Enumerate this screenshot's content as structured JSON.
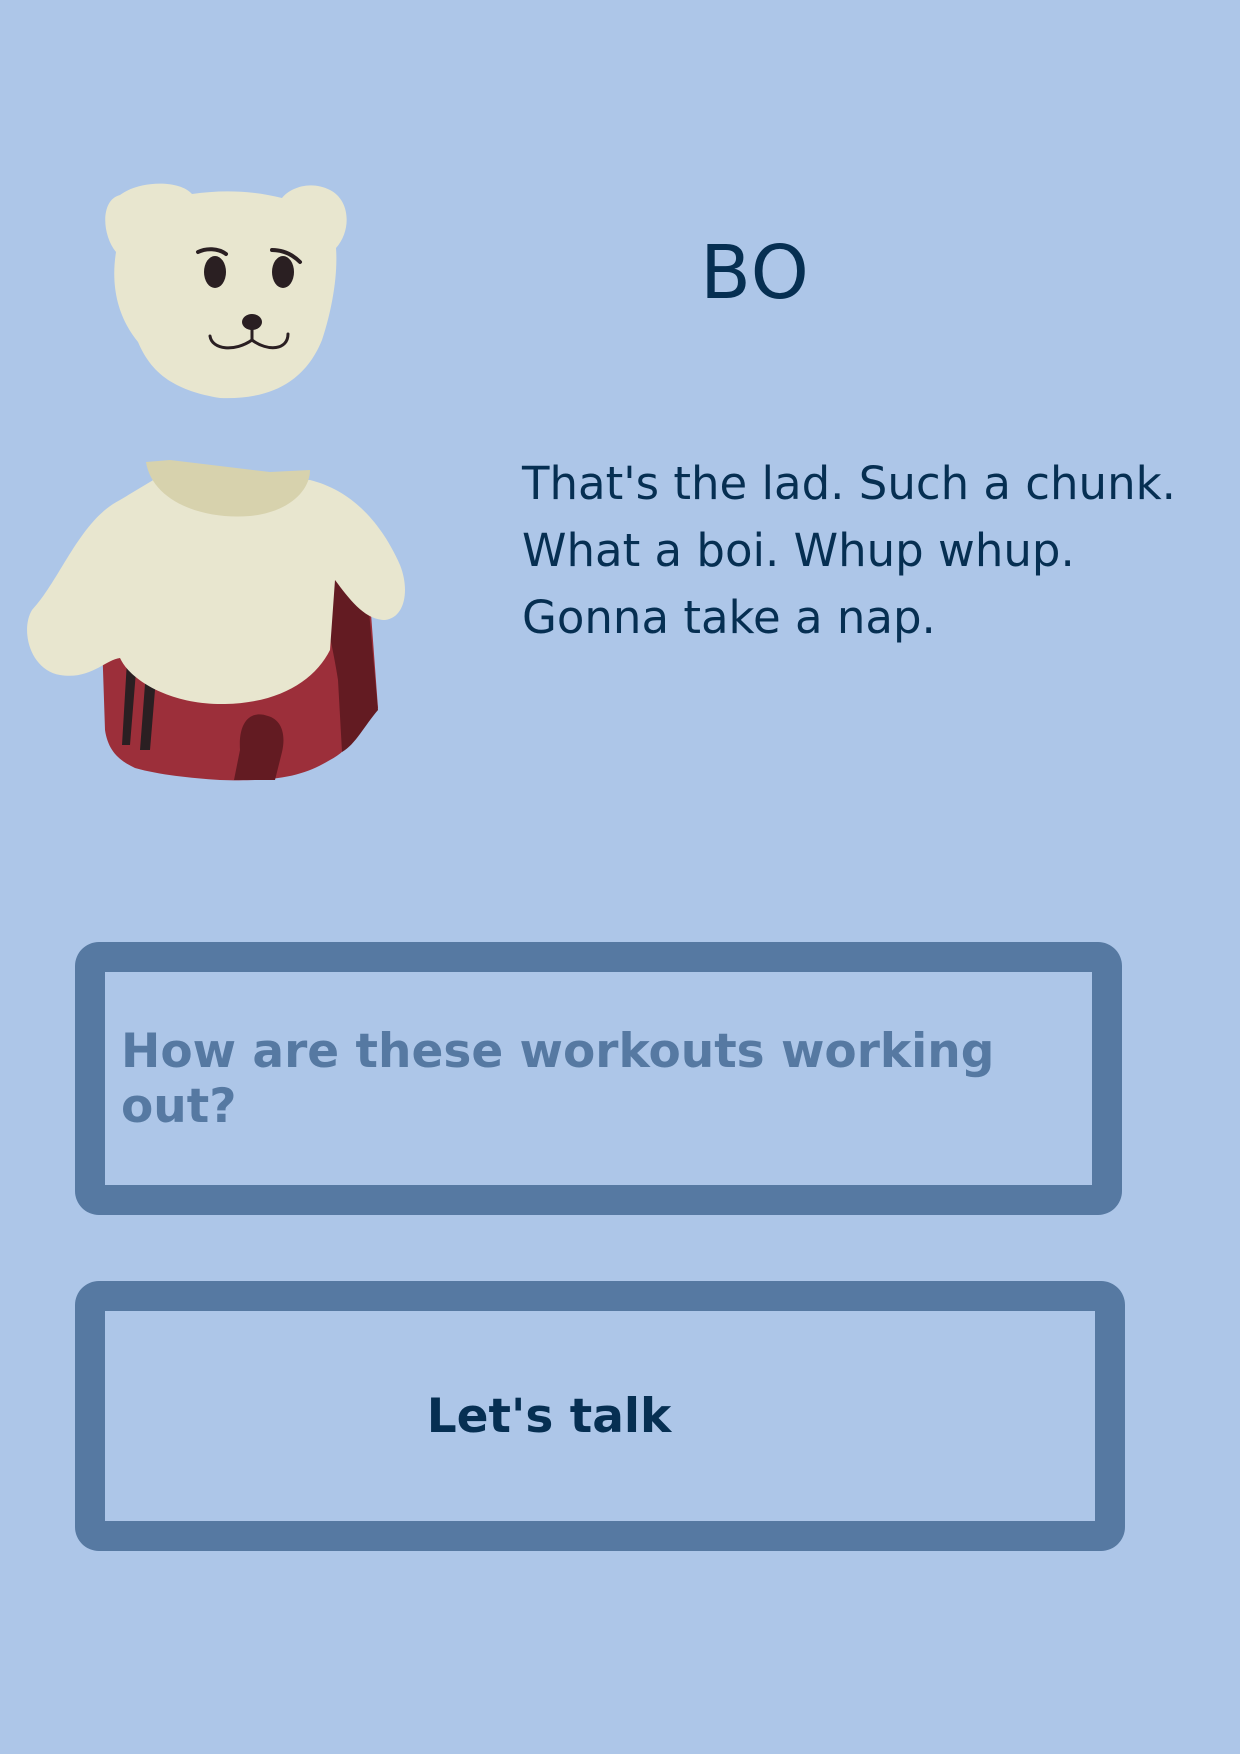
{
  "character": {
    "name": "BO",
    "portrait": "polar-bear-in-red-tracksuit-pants"
  },
  "dialogue": {
    "lines": [
      "That's the lad. Such a chunk.",
      "What a boi. Whup whup.",
      "Gonna take a nap."
    ]
  },
  "choices": [
    {
      "label": "How are these workouts working out?",
      "state": "dimmed"
    },
    {
      "label": "Let's talk",
      "state": "active"
    }
  ],
  "colors": {
    "background": "#adc6e8",
    "text": "#062f52",
    "button_border": "#5679a2",
    "bear_fur": "#e8e6cf",
    "bear_shadow": "#d7d2ad",
    "pants": "#9c2f3a",
    "pants_shadow": "#631b22"
  }
}
